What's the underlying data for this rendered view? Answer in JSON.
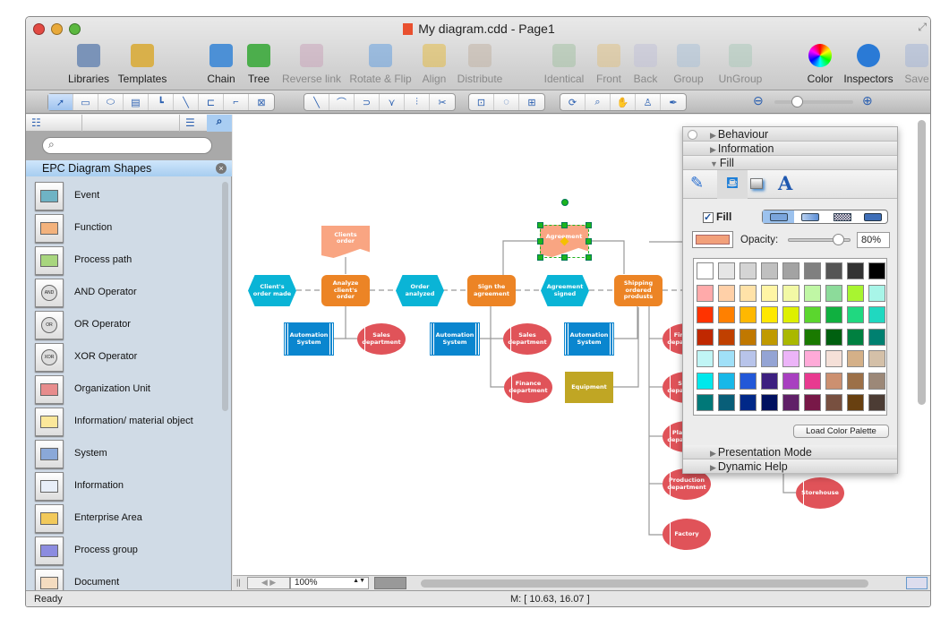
{
  "window": {
    "title": "My diagram.cdd - Page1"
  },
  "toolbar": [
    {
      "label": "Libraries",
      "icon": "libraries-icon",
      "enabled": true
    },
    {
      "label": "Templates",
      "icon": "templates-icon",
      "enabled": true
    },
    {
      "label": "Chain",
      "icon": "chain-icon",
      "enabled": true
    },
    {
      "label": "Tree",
      "icon": "tree-icon",
      "enabled": true
    },
    {
      "label": "Reverse link",
      "icon": "reverse-link-icon",
      "enabled": false
    },
    {
      "label": "Rotate & Flip",
      "icon": "rotate-flip-icon",
      "enabled": false
    },
    {
      "label": "Align",
      "icon": "align-icon",
      "enabled": false
    },
    {
      "label": "Distribute",
      "icon": "distribute-icon",
      "enabled": false
    },
    {
      "label": "Identical",
      "icon": "identical-icon",
      "enabled": false
    },
    {
      "label": "Front",
      "icon": "front-icon",
      "enabled": false
    },
    {
      "label": "Back",
      "icon": "back-icon",
      "enabled": false
    },
    {
      "label": "Group",
      "icon": "group-icon",
      "enabled": false
    },
    {
      "label": "UnGroup",
      "icon": "ungroup-icon",
      "enabled": false
    },
    {
      "label": "Color",
      "icon": "color-wheel-icon",
      "enabled": true
    },
    {
      "label": "Inspectors",
      "icon": "info-icon",
      "enabled": true
    },
    {
      "label": "Save",
      "icon": "save-icon",
      "enabled": false
    }
  ],
  "tools": [
    [
      "pointer-tool",
      "rectangle-tool",
      "ellipse-tool",
      "text-tool",
      "orthogonal-connector-tool",
      "direct-connector-tool",
      "smart-connector-tool",
      "round-connector-tool",
      "insert-tool"
    ],
    [
      "line-tool",
      "arc-tool",
      "bezier-tool",
      "polyline-tool",
      "spline-tool",
      "scissors-tool"
    ],
    [
      "bring-points-tool",
      "curve-points-tool",
      "group-points-tool"
    ],
    [
      "rotate-view-tool",
      "zoom-tool",
      "hand-tool",
      "stamp-tool",
      "eyedropper-tool"
    ]
  ],
  "library": {
    "search_placeholder": "",
    "title": "EPC Diagram Shapes",
    "items": [
      "Event",
      "Function",
      "Process path",
      "AND Operator",
      "OR Operator",
      "XOR Operator",
      "Organization Unit",
      "Information/ material object",
      "System",
      "Information",
      "Enterprise Area",
      "Process group",
      "Document"
    ]
  },
  "diagram": {
    "nodes": [
      {
        "id": "e1",
        "type": "event",
        "text": "Client's order made"
      },
      {
        "id": "f1",
        "type": "function",
        "text": "Analyze client's order"
      },
      {
        "id": "d1",
        "type": "document",
        "text": "Clients order"
      },
      {
        "id": "e2",
        "type": "event",
        "text": "Order analyzed"
      },
      {
        "id": "f2",
        "type": "function",
        "text": "Sign the agreement"
      },
      {
        "id": "d2",
        "type": "document",
        "text": "Agreement"
      },
      {
        "id": "e3",
        "type": "event",
        "text": "Agreement signed"
      },
      {
        "id": "f3",
        "type": "function",
        "text": "Shipping ordered produsts"
      },
      {
        "id": "s1",
        "type": "system",
        "text": "Automation System"
      },
      {
        "id": "o1",
        "type": "org",
        "text": "Sales department"
      },
      {
        "id": "s2",
        "type": "system",
        "text": "Automation System"
      },
      {
        "id": "o2",
        "type": "org",
        "text": "Sales department"
      },
      {
        "id": "o3",
        "type": "org",
        "text": "Finance department"
      },
      {
        "id": "s3",
        "type": "system",
        "text": "Automation System"
      },
      {
        "id": "i1",
        "type": "info",
        "text": "Equipment"
      },
      {
        "id": "o4",
        "type": "org",
        "text": "Finance department"
      },
      {
        "id": "o5",
        "type": "org",
        "text": "Sales department"
      },
      {
        "id": "o6",
        "type": "org",
        "text": "Planning department"
      },
      {
        "id": "o7",
        "type": "org",
        "text": "Production department"
      },
      {
        "id": "o8",
        "type": "org",
        "text": "Factory"
      },
      {
        "id": "o9",
        "type": "org",
        "text": "Storehouse"
      }
    ],
    "selected": "Agreement",
    "colors": {
      "event": "#0ab4d6",
      "function": "#ec8425",
      "document": "#f9a582",
      "system": "#0a86cf",
      "org": "#e05359",
      "info": "#c0a624"
    }
  },
  "inspector": {
    "sections_top": [
      "Behaviour",
      "Information",
      "Fill"
    ],
    "sections_bottom": [
      "Presentation Mode",
      "Dynamic Help"
    ],
    "fill_checkbox": "Fill",
    "fill_checked": true,
    "current_color": "#f2a07a",
    "opacity_label": "Opacity:",
    "opacity_value": "80%",
    "opacity": 80,
    "palette": [
      [
        "#ffffff",
        "#e6e6e6",
        "#d4d4d4",
        "#c0c0c0",
        "#a3a3a3",
        "#808080",
        "#555555",
        "#333333",
        "#000000"
      ],
      [
        "#ffaaaa",
        "#ffd0a8",
        "#ffe2a8",
        "#fff5a5",
        "#f2f9a5",
        "#c0f7a5",
        "#8cdb9a",
        "#a8f530",
        "#a8f5e8"
      ],
      [
        "#ff3300",
        "#ff8000",
        "#ffb800",
        "#ffe800",
        "#def000",
        "#5bd62e",
        "#10b040",
        "#20d880",
        "#20d8c0"
      ],
      [
        "#c02800",
        "#c04000",
        "#c07800",
        "#c09a00",
        "#aab800",
        "#1a7a00",
        "#006010",
        "#008040",
        "#008070"
      ],
      [
        "#c0f5f5",
        "#a0e0f8",
        "#b8c4ea",
        "#94a4d4",
        "#ecb4f8",
        "#ffaad8",
        "#f5e0d8",
        "#d4b088",
        "#d4c0a8"
      ],
      [
        "#00e8ec",
        "#18b8e8",
        "#2258d8",
        "#3c2080",
        "#a840c0",
        "#e83a90",
        "#cc9070",
        "#9c7048",
        "#9c8878"
      ],
      [
        "#007878",
        "#085e78",
        "#002888",
        "#001060",
        "#602068",
        "#781848",
        "#785040",
        "#684010",
        "#4c3c34"
      ]
    ],
    "load_palette": "Load Color Palette"
  },
  "bottom": {
    "zoom": "100%"
  },
  "status": {
    "left": "Ready",
    "mouse": "M: [ 10.63, 16.07 ]"
  }
}
